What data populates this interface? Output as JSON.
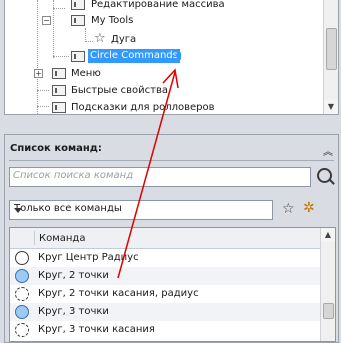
{
  "tree": {
    "items": [
      {
        "label": "Редактирование массива"
      },
      {
        "label": "My Tools"
      },
      {
        "label": "Дуга"
      },
      {
        "label": "Circle Commands"
      },
      {
        "label": "Меню"
      },
      {
        "label": "Быстрые свойства"
      },
      {
        "label": "Подсказки для ролловеров"
      }
    ]
  },
  "command_list": {
    "title": "Список команд:",
    "search_placeholder": "Список поиска команд",
    "filter_selected": "Только все команды",
    "column_header": "Команда",
    "rows": [
      {
        "label": "Круг Центр Радиус"
      },
      {
        "label": "Круг, 2 точки"
      },
      {
        "label": "Круг, 2 точки касания, радиус"
      },
      {
        "label": "Круг, 3 точки"
      },
      {
        "label": "Круг, 3 точки касания"
      }
    ]
  },
  "colors": {
    "selection": "#3399ff",
    "annotation_arrow": "#e00000"
  }
}
